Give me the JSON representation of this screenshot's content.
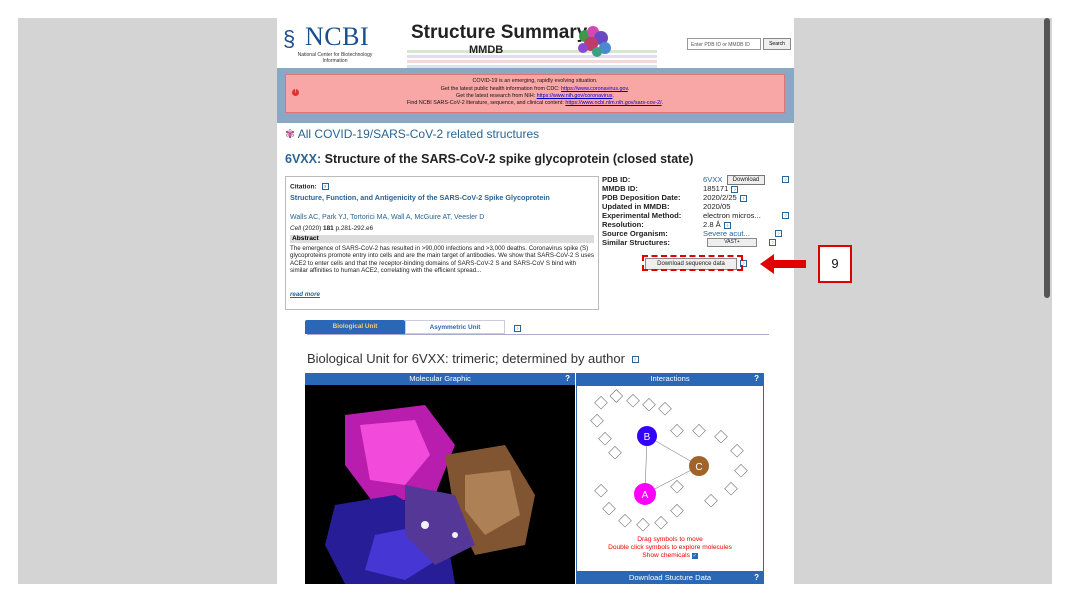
{
  "header": {
    "ncbi_name": "NCBI",
    "ncbi_full": "National Center for Biotechnology Information",
    "banner_title": "Structure Summary",
    "banner_sub": "MMDB",
    "search_placeholder": "Enter PDB ID or MMDB ID",
    "search_button": "Search"
  },
  "covid": {
    "line1": "COVID-19 is an emerging, rapidly evolving situation.",
    "line2_prefix": "Get the latest public health information from CDC: ",
    "line2_link": "https://www.coronavirus.gov",
    "line3_prefix": "Get the latest research from NIH: ",
    "line3_link": "https://www.nih.gov/coronavirus",
    "line4_prefix": "Find NCBI SARS-CoV-2 literature, sequence, and clinical content: ",
    "line4_link": "https://www.ncbi.nlm.nih.gov/sars-cov-2/"
  },
  "covid_link": "All COVID-19/SARS-CoV-2 related structures",
  "structure": {
    "id": "6VXX:",
    "title": "Structure of the SARS-CoV-2 spike glycoprotein (closed state)"
  },
  "citation": {
    "label": "Citation:",
    "title": "Structure, Function, and Antigenicity of the SARS-CoV-2 Spike Glycoprotein",
    "authors": "Walls AC,  Park YJ,  Tortorici MA,  Wall A,  McGuire AT,  Veesler D",
    "journal": "Cell",
    "year_pages": " (2020) ",
    "volume": "181",
    "pages": " p.281-292.e6",
    "abstract_head": "Abstract",
    "abstract": "The emergence of SARS-CoV-2 has resulted in >90,000 infections and >3,000 deaths. Coronavirus spike (S) glycoproteins promote entry into cells and are the main target of antibodies. We show that SARS-CoV-2 S uses ACE2 to enter cells and that the receptor-binding domains of SARS-CoV-2 S and SARS-CoV S bind with similar affinities to human ACE2, correlating with the efficient spread...",
    "read_more": "read more"
  },
  "info": [
    {
      "key": "PDB ID:",
      "val": "6VXX"
    },
    {
      "key": "MMDB ID:",
      "val": "185171"
    },
    {
      "key": "PDB Deposition Date:",
      "val": "2020/2/25"
    },
    {
      "key": "Updated in MMDB:",
      "val": "2020/05"
    },
    {
      "key": "Experimental Method:",
      "val": "electron micros..."
    },
    {
      "key": "Resolution:",
      "val": "2.8  Å"
    },
    {
      "key": "Source Organism:",
      "val": "Severe acut..."
    },
    {
      "key": "Similar Structures:",
      "val": ""
    }
  ],
  "download_label": "Download",
  "vast_label": "VAST+",
  "seq_button": "Download sequence data",
  "tabs": {
    "bio": "Biological Unit",
    "asym": "Asymmetric Unit"
  },
  "bio_title": "Biological Unit for 6VXX: trimeric; determined by author",
  "panels": {
    "mol": "Molecular Graphic",
    "int": "Interactions",
    "q": "?",
    "drag": "Drag symbols to move",
    "dbl": "Double click symbols to explore molecules",
    "show_chem": "Show chemicals",
    "download": "Download Stucture Data",
    "nodes": [
      "A",
      "B",
      "C"
    ]
  },
  "callout": "9",
  "colors": {
    "node_a": "#ff00ff",
    "node_b": "#3300ff",
    "node_c": "#a0632a",
    "accent": "#2a67b4",
    "annotation": "#e00000"
  }
}
